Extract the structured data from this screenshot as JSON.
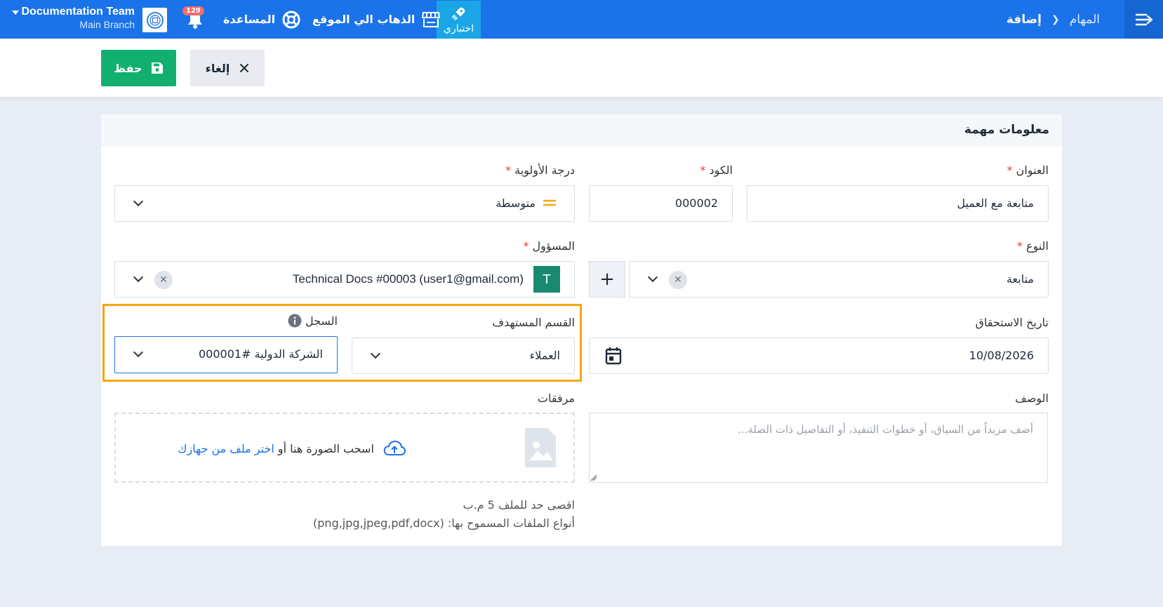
{
  "topbar": {
    "breadcrumb_parent": "المهام",
    "breadcrumb_current": "إضافة",
    "demo_label": "اختباري",
    "goto_site": "الذهاب الي الموقع",
    "help": "المساعدة",
    "notifications_count": "129",
    "account_name": "Documentation Team",
    "account_branch": "Main Branch"
  },
  "actions": {
    "save": "حفظ",
    "cancel": "إلغاء"
  },
  "card": {
    "title": "معلومات مهمة"
  },
  "form": {
    "title_label": "العنوان",
    "title_value": "متابعة مع العميل",
    "code_label": "الكود",
    "code_value": "000002",
    "priority_label": "درجة الأولوية",
    "priority_value": "متوسطة",
    "type_label": "النوع",
    "type_value": "متابعة",
    "assignee_label": "المسؤول",
    "assignee_avatar": "T",
    "assignee_value": "Technical Docs #00003 (user1@gmail.com)",
    "due_label": "تاريخ الاستحقاق",
    "due_value": "10/08/2026",
    "target_label": "القسم المستهدف",
    "target_value": "العملاء",
    "record_label": "السجل",
    "record_value": "الشركة الدولية #000001",
    "description_label": "الوصف",
    "description_placeholder": "أضف مزيداً من السياق، أو خطوات التنفيذ، أو التفاصيل ذات الصلة...",
    "attachments_label": "مرفقات",
    "dropzone_text": "اسحب الصورة هنا أو",
    "dropzone_link": "اختر ملف من جهازك",
    "hint_size": "اقصى حد للملف 5 م.ب",
    "hint_types": "أنواع الملفات المسموح بها: (png,jpg,jpeg,pdf,docx)",
    "required_mark": "*"
  },
  "colors": {
    "primary": "#1a73e8",
    "save": "#12b06e",
    "highlight": "#f6a611",
    "avatar": "#178a6f"
  }
}
